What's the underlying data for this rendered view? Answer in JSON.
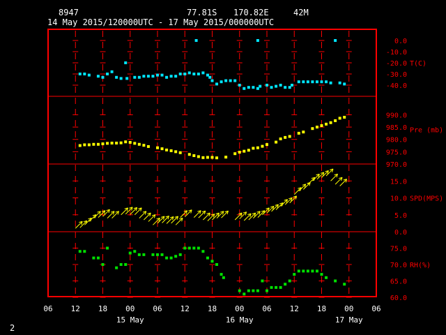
{
  "header": {
    "station": "8947",
    "lat": "77.81S",
    "lon": "170.82E",
    "elev": "42M",
    "range": "14 May 2015/120000UTC - 17 May 2015/000000UTC"
  },
  "page_number": "2",
  "colors": {
    "background": "#000000",
    "frame": "#ff0000",
    "axis_text": "#ff0000",
    "header_text": "#ffffff",
    "temperature": "#00e5ff",
    "pressure": "#ffff00",
    "wind": "#ffff00",
    "humidity": "#00e000"
  },
  "chart_data": {
    "type": "scatter",
    "x_unit": "hours since 14 May 2015 06 UTC",
    "x_ticks": [
      {
        "x": 0,
        "label": "06"
      },
      {
        "x": 6,
        "label": "12"
      },
      {
        "x": 12,
        "label": "18"
      },
      {
        "x": 18,
        "label": "00"
      },
      {
        "x": 24,
        "label": "06"
      },
      {
        "x": 30,
        "label": "12"
      },
      {
        "x": 36,
        "label": "18"
      },
      {
        "x": 42,
        "label": "00"
      },
      {
        "x": 48,
        "label": "06"
      },
      {
        "x": 54,
        "label": "12"
      },
      {
        "x": 60,
        "label": "18"
      },
      {
        "x": 66,
        "label": "00"
      },
      {
        "x": 72,
        "label": "06"
      }
    ],
    "x_range": [
      0,
      72
    ],
    "date_labels": [
      {
        "x": 18,
        "label": "15 May"
      },
      {
        "x": 42,
        "label": "16 May"
      },
      {
        "x": 66,
        "label": "17 May"
      }
    ],
    "panels": [
      {
        "key": "temp",
        "title": "T(C)",
        "kind": "points",
        "color_key": "temperature",
        "ylim": [
          -50,
          10
        ],
        "ticks": [
          {
            "v": 0,
            "label": "0.0"
          },
          {
            "v": -10,
            "label": "-10.0"
          },
          {
            "v": -20,
            "label": "-20.0"
          },
          {
            "v": -30,
            "label": "-30.0"
          },
          {
            "v": -40,
            "label": "-40.0"
          }
        ],
        "title_value": -20,
        "points": [
          [
            7,
            -30
          ],
          [
            8,
            -30
          ],
          [
            9,
            -31
          ],
          [
            11,
            -32
          ],
          [
            12,
            -33
          ],
          [
            13,
            -30
          ],
          [
            14,
            -28
          ],
          [
            15,
            -33
          ],
          [
            16,
            -34
          ],
          [
            17,
            -20
          ],
          [
            17.3,
            -34
          ],
          [
            19,
            -33
          ],
          [
            20,
            -33
          ],
          [
            21,
            -32
          ],
          [
            22,
            -32
          ],
          [
            23,
            -32
          ],
          [
            24,
            -31
          ],
          [
            25,
            -31
          ],
          [
            26,
            -33
          ],
          [
            27,
            -32
          ],
          [
            28,
            -32
          ],
          [
            29,
            -30
          ],
          [
            30,
            -30
          ],
          [
            31,
            -29
          ],
          [
            32,
            -30
          ],
          [
            33,
            -30
          ],
          [
            34,
            -29
          ],
          [
            35,
            -31
          ],
          [
            35.5,
            -33
          ],
          [
            36,
            -36
          ],
          [
            37,
            -39
          ],
          [
            38,
            -37
          ],
          [
            39,
            -36
          ],
          [
            40,
            -36
          ],
          [
            41,
            -36
          ],
          [
            42,
            -40
          ],
          [
            43,
            -43
          ],
          [
            44,
            -42
          ],
          [
            45,
            -42
          ],
          [
            46,
            -43
          ],
          [
            46.5,
            -41
          ],
          [
            48,
            -40
          ],
          [
            49,
            -42
          ],
          [
            50,
            -41
          ],
          [
            51,
            -40
          ],
          [
            52,
            -42
          ],
          [
            53,
            -42
          ],
          [
            53.5,
            -40
          ],
          [
            55,
            -37
          ],
          [
            56,
            -37
          ],
          [
            57,
            -37
          ],
          [
            58,
            -37
          ],
          [
            59,
            -37
          ],
          [
            60,
            -37
          ],
          [
            61,
            -37
          ],
          [
            62,
            -38
          ],
          [
            64,
            -38
          ],
          [
            65,
            -39
          ],
          [
            32.5,
            0
          ],
          [
            46,
            0
          ],
          [
            63,
            0
          ]
        ]
      },
      {
        "key": "pres",
        "title": "Pre (mb)",
        "kind": "points",
        "color_key": "pressure",
        "ylim": [
          970,
          997.5
        ],
        "ticks": [
          {
            "v": 990,
            "label": "990.0"
          },
          {
            "v": 985,
            "label": "985.0"
          },
          {
            "v": 980,
            "label": "980.0"
          },
          {
            "v": 975,
            "label": "975.0"
          },
          {
            "v": 970,
            "label": "970.0"
          }
        ],
        "title_value": 984,
        "points": [
          [
            7,
            977.5
          ],
          [
            8,
            977.8
          ],
          [
            9,
            977.8
          ],
          [
            10,
            978
          ],
          [
            11,
            978
          ],
          [
            12,
            978.2
          ],
          [
            13,
            978.4
          ],
          [
            14,
            978.5
          ],
          [
            15,
            978.5
          ],
          [
            16,
            978.6
          ],
          [
            17,
            979
          ],
          [
            18,
            978.8
          ],
          [
            19,
            978.4
          ],
          [
            20,
            978
          ],
          [
            21,
            977.6
          ],
          [
            22,
            977.1
          ],
          [
            24,
            976.6
          ],
          [
            25,
            976.2
          ],
          [
            26,
            975.7
          ],
          [
            27,
            975.4
          ],
          [
            28,
            975
          ],
          [
            29,
            974.6
          ],
          [
            31,
            973.9
          ],
          [
            32,
            973.4
          ],
          [
            33,
            973
          ],
          [
            34,
            972.6
          ],
          [
            35,
            972.7
          ],
          [
            36,
            972.7
          ],
          [
            37,
            972.5
          ],
          [
            39,
            972.8
          ],
          [
            41,
            974.2
          ],
          [
            42,
            974.8
          ],
          [
            43,
            975.2
          ],
          [
            44,
            975.6
          ],
          [
            45,
            976.4
          ],
          [
            46,
            976.6
          ],
          [
            47,
            977.2
          ],
          [
            48,
            977.9
          ],
          [
            50,
            978.9
          ],
          [
            51,
            980.2
          ],
          [
            52,
            980.8
          ],
          [
            53,
            981.2
          ],
          [
            55,
            982.5
          ],
          [
            56,
            983
          ],
          [
            58,
            984.4
          ],
          [
            59,
            985
          ],
          [
            60,
            985.6
          ],
          [
            61,
            986.2
          ],
          [
            62,
            986.8
          ],
          [
            63,
            987.6
          ],
          [
            64,
            988.6
          ],
          [
            65,
            989
          ]
        ]
      },
      {
        "key": "wind",
        "title": "SPD(MPS)",
        "kind": "arrows",
        "color_key": "wind",
        "ylim": [
          0,
          20
        ],
        "ticks": [
          {
            "v": 15,
            "label": "15.0"
          },
          {
            "v": 10,
            "label": "10.0"
          },
          {
            "v": 5,
            "label": "5.0"
          },
          {
            "v": 0,
            "label": "0.0"
          }
        ],
        "title_value": 10,
        "points": [
          [
            6,
            1
          ],
          [
            7,
            1.2
          ],
          [
            8,
            2
          ],
          [
            9,
            3
          ],
          [
            10,
            4
          ],
          [
            11,
            4.2
          ],
          [
            12,
            4.5
          ],
          [
            13,
            4
          ],
          [
            14,
            4
          ],
          [
            16,
            5
          ],
          [
            17,
            5.2
          ],
          [
            18,
            5.1
          ],
          [
            19,
            5
          ],
          [
            20,
            4
          ],
          [
            21,
            3.5
          ],
          [
            22,
            3
          ],
          [
            23,
            2
          ],
          [
            24,
            2.5
          ],
          [
            25,
            2.6
          ],
          [
            26,
            2.4
          ],
          [
            27,
            2.5
          ],
          [
            28,
            2
          ],
          [
            29,
            4.2
          ],
          [
            30,
            4.4
          ],
          [
            32,
            4.2
          ],
          [
            33,
            4.1
          ],
          [
            34,
            3.5
          ],
          [
            35,
            3.2
          ],
          [
            36,
            3.5
          ],
          [
            37,
            4
          ],
          [
            38,
            4.1
          ],
          [
            41,
            3.5
          ],
          [
            42,
            3.8
          ],
          [
            43,
            3.3
          ],
          [
            44,
            3.5
          ],
          [
            45,
            4
          ],
          [
            46,
            4.2
          ],
          [
            47,
            5
          ],
          [
            48,
            5.5
          ],
          [
            49,
            6
          ],
          [
            50,
            6.5
          ],
          [
            51,
            7.5
          ],
          [
            52,
            8
          ],
          [
            53,
            8.5
          ],
          [
            54,
            11
          ],
          [
            55,
            12
          ],
          [
            56,
            12.5
          ],
          [
            57,
            14
          ],
          [
            58,
            15
          ],
          [
            59,
            15.5
          ],
          [
            60,
            16
          ],
          [
            61,
            16.5
          ],
          [
            62,
            15
          ],
          [
            63,
            14
          ],
          [
            64,
            13.5
          ]
        ]
      },
      {
        "key": "rh",
        "title": "RH(%)",
        "kind": "points",
        "color_key": "humidity",
        "ylim": [
          60,
          80
        ],
        "ticks": [
          {
            "v": 75,
            "label": "75.0"
          },
          {
            "v": 70,
            "label": "70.0"
          },
          {
            "v": 65,
            "label": "65.0"
          },
          {
            "v": 60,
            "label": "60.0"
          }
        ],
        "title_value": 70,
        "points": [
          [
            7,
            74
          ],
          [
            8,
            74
          ],
          [
            10,
            72
          ],
          [
            11,
            72
          ],
          [
            12,
            70
          ],
          [
            13,
            75
          ],
          [
            15,
            69
          ],
          [
            16,
            70
          ],
          [
            17,
            70
          ],
          [
            18,
            73.5
          ],
          [
            19,
            74
          ],
          [
            20,
            73
          ],
          [
            21,
            73
          ],
          [
            23,
            73
          ],
          [
            24,
            73
          ],
          [
            25,
            73
          ],
          [
            26,
            72
          ],
          [
            27,
            72
          ],
          [
            28,
            72.5
          ],
          [
            29,
            73
          ],
          [
            30,
            75
          ],
          [
            31,
            75
          ],
          [
            32,
            75
          ],
          [
            33,
            75
          ],
          [
            34,
            74
          ],
          [
            35,
            72
          ],
          [
            36,
            71
          ],
          [
            37,
            70
          ],
          [
            38,
            67
          ],
          [
            38.5,
            66
          ],
          [
            42,
            62
          ],
          [
            43,
            61
          ],
          [
            44,
            62
          ],
          [
            45,
            62
          ],
          [
            46,
            62
          ],
          [
            47,
            65
          ],
          [
            48,
            62
          ],
          [
            49,
            63
          ],
          [
            50,
            63
          ],
          [
            51,
            63
          ],
          [
            52,
            64
          ],
          [
            53,
            65
          ],
          [
            54,
            67
          ],
          [
            55,
            68
          ],
          [
            56,
            68
          ],
          [
            57,
            68
          ],
          [
            58,
            68
          ],
          [
            59,
            68
          ],
          [
            60,
            67
          ],
          [
            61,
            66
          ],
          [
            63,
            65
          ],
          [
            65,
            64
          ]
        ]
      }
    ]
  }
}
